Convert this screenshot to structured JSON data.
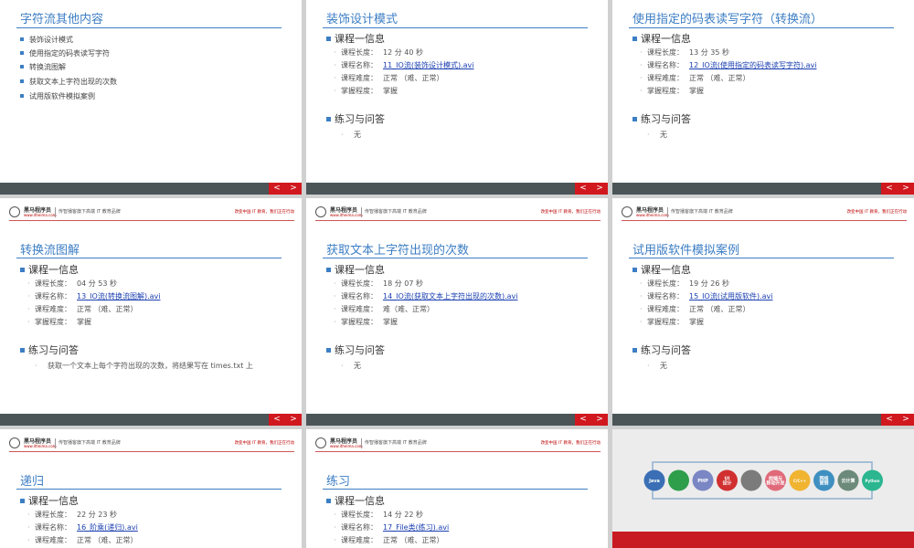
{
  "header": {
    "brand_name": "黑马程序员",
    "brand_url": "www.itheima.com",
    "tagline": "传智播客旗下高端 IT 教育品牌",
    "slogan": "改变中国 IT 教育，我们正在行动"
  },
  "labels": {
    "course_info": "课程一信息",
    "practice": "练习与问答",
    "length": "课程长度：",
    "name": "课程名称：",
    "difficulty": "课程难度：",
    "mastery": "掌握程度："
  },
  "nav": {
    "prev": "<",
    "next": ">"
  },
  "slide1": {
    "title": "字符流其他内容",
    "items": [
      "装饰设计模式",
      "使用指定的码表读写字符",
      "转换流图解",
      "获取文本上字符出现的次数",
      "试用版软件模拟案例"
    ]
  },
  "slide2": {
    "title": "装饰设计模式",
    "length": "12 分 40 秒",
    "name": "11_IO流(装饰设计模式).avi",
    "difficulty": "正常   （难、正常）",
    "mastery": "掌握",
    "qa": "无"
  },
  "slide3": {
    "title": "使用指定的码表读写字符（转换流）",
    "length": "13 分 35 秒",
    "name": "12_IO流(使用指定的码表读写字符).avi",
    "difficulty": "正常   （难、正常）",
    "mastery": "掌握",
    "qa": "无"
  },
  "slide4": {
    "title": "转换流图解",
    "length": "04 分 53 秒",
    "name": "13_IO流(转换流图解).avi",
    "difficulty": "正常   （难、正常）",
    "mastery": "掌握",
    "qa": "获取一个文本上每个字符出现的次数，将结果写在 times.txt 上"
  },
  "slide5": {
    "title": "获取文本上字符出现的次数",
    "length": "18 分 07 秒",
    "name": "14_IO流(获取文本上字符出现的次数).avi",
    "difficulty": "难（难、正常）",
    "mastery": "掌握",
    "qa": "无"
  },
  "slide6": {
    "title": "试用版软件模拟案例",
    "length": "19 分 26 秒",
    "name": "15_IO流(试用版软件).avi",
    "difficulty": "正常   （难、正常）",
    "mastery": "掌握",
    "qa": "无"
  },
  "slide7": {
    "title": "递归",
    "length": "22 分 23 秒",
    "name": "16_阶乘(递归).avi",
    "difficulty": "正常   （难、正常）"
  },
  "slide8": {
    "title": "练习",
    "length": "14 分 22 秒",
    "name": "17_File类(练习).avi",
    "difficulty": "正常   （难、正常）"
  },
  "tech_icons": [
    {
      "name": "java-icon",
      "label": "Java",
      "color": "#3a6fb5"
    },
    {
      "name": "android-icon",
      "label": "",
      "color": "#2e9e4a"
    },
    {
      "name": "php-icon",
      "label": "PHP",
      "color": "#7a87c4"
    },
    {
      "name": "ui-design-icon",
      "label": "UI\n设计",
      "color": "#d0302f"
    },
    {
      "name": "apple-ios-icon",
      "label": "",
      "color": "#7b7b7b"
    },
    {
      "name": "frontend-icon",
      "label": "前端与\n移动开发",
      "color": "#e06a7a"
    },
    {
      "name": "cpp-icon",
      "label": "C/C++",
      "color": "#f0b431"
    },
    {
      "name": "web-bigdata-icon",
      "label": "网络\n营销",
      "color": "#3f8fc1"
    },
    {
      "name": "cloud-icon",
      "label": "云计算",
      "color": "#6c8a7a"
    },
    {
      "name": "python-icon",
      "label": "Python",
      "color": "#2bb68f"
    }
  ]
}
